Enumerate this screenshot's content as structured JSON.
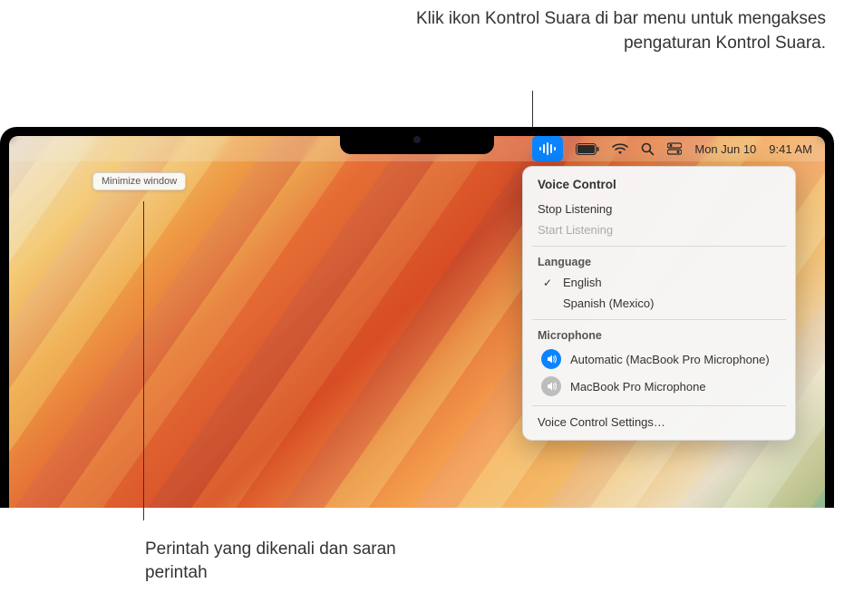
{
  "annotations": {
    "top": "Klik ikon Kontrol Suara di bar menu untuk mengakses pengaturan Kontrol Suara.",
    "bottom": "Perintah yang dikenali dan saran perintah"
  },
  "command_bubble": "Minimize window",
  "menubar": {
    "date": "Mon Jun 10",
    "time": "9:41 AM"
  },
  "dropdown": {
    "title": "Voice Control",
    "stop": "Stop Listening",
    "start": "Start Listening",
    "language_header": "Language",
    "languages": [
      {
        "label": "English",
        "selected": true
      },
      {
        "label": "Spanish (Mexico)",
        "selected": false
      }
    ],
    "microphone_header": "Microphone",
    "microphones": [
      {
        "label": "Automatic (MacBook Pro Microphone)",
        "active": true
      },
      {
        "label": "MacBook Pro Microphone",
        "active": false
      }
    ],
    "settings": "Voice Control Settings…"
  },
  "colors": {
    "accent": "#0a84ff"
  }
}
